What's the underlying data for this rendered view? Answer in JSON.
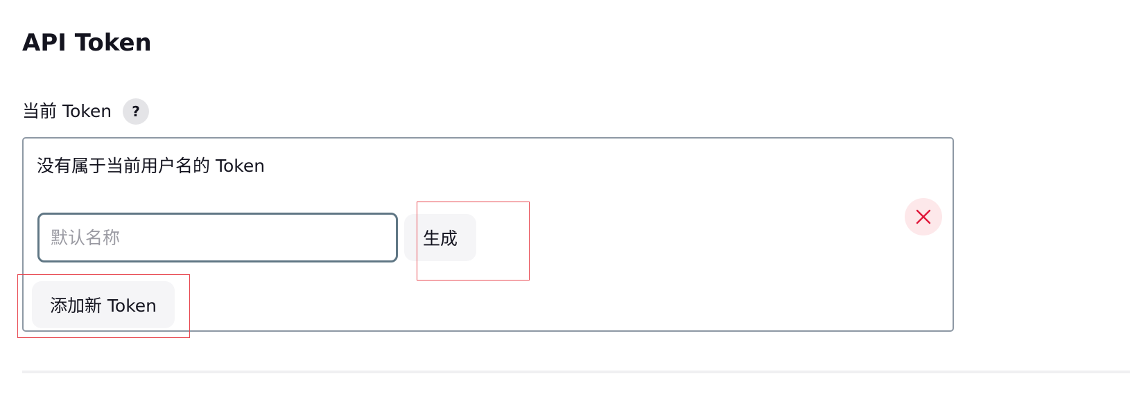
{
  "page_title": "API Token",
  "current_tokens": {
    "label": "当前 Token",
    "help_label": "?",
    "empty_message": "没有属于当前用户名的 Token"
  },
  "token_form": {
    "name_placeholder": "默认名称",
    "name_value": "",
    "generate_label": "生成",
    "remove_icon": "close-icon"
  },
  "add_token_label": "添加新 Token",
  "colors": {
    "remove_icon": "#e0173a",
    "remove_bg": "#fde8ea",
    "input_border": "#5f7684",
    "annotation_box": "#e8474f"
  }
}
